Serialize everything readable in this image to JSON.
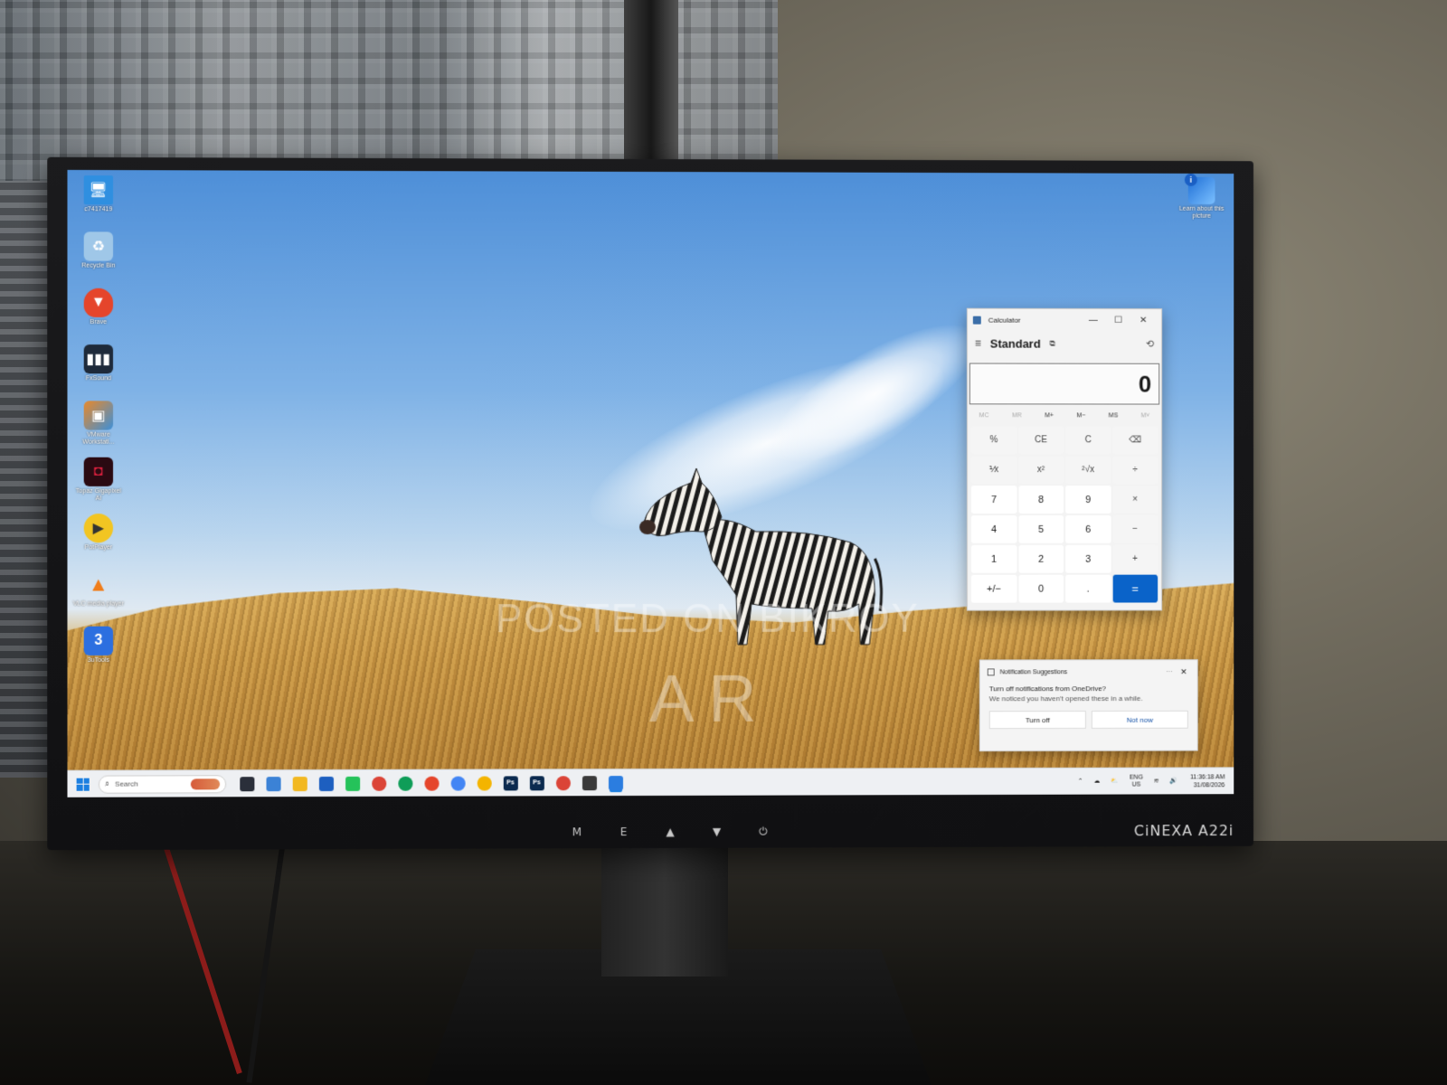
{
  "monitor": {
    "brand": "CiNEXA A22i",
    "buttons": [
      "M",
      "E",
      "▲",
      "▼",
      "⏻"
    ]
  },
  "wallpaper": {
    "watermark_line1": "POSTED ON BIKROY",
    "watermark_line2": "AR"
  },
  "desktop_icons": [
    {
      "label": "c7417419",
      "icon": "this-pc-icon",
      "color": "#2f8fe0"
    },
    {
      "label": "Recycle Bin",
      "icon": "recycle-bin-icon",
      "color": "#9fc7e8"
    },
    {
      "label": "Brave",
      "icon": "brave-icon",
      "color": "#e5452b"
    },
    {
      "label": "FxSound",
      "icon": "fxsound-icon",
      "color": "#1e2a3a"
    },
    {
      "label": "VMware Workstati...",
      "icon": "vmware-icon",
      "color": "#e9892a"
    },
    {
      "label": "Topaz Gigapixel AI",
      "icon": "topaz-icon",
      "color": "#b0102c"
    },
    {
      "label": "PotPlayer",
      "icon": "potplayer-icon",
      "color": "#f2c522"
    },
    {
      "label": "VLC media player",
      "icon": "vlc-icon",
      "color": "#f07d1a"
    },
    {
      "label": "3uTools",
      "icon": "3utools-icon",
      "color": "#2c6fe0"
    }
  ],
  "learn_picture": {
    "label": "Learn about this picture",
    "dot": "i"
  },
  "calculator": {
    "title": "Calculator",
    "mode": "Standard",
    "display": "0",
    "memory": [
      "MC",
      "MR",
      "M+",
      "M−",
      "MS",
      "M˅"
    ],
    "keys": [
      "%",
      "CE",
      "C",
      "⌫",
      "⅟x",
      "x²",
      "²√x",
      "÷",
      "7",
      "8",
      "9",
      "×",
      "4",
      "5",
      "6",
      "−",
      "1",
      "2",
      "3",
      "+",
      "+/−",
      "0",
      ".",
      "="
    ]
  },
  "notification": {
    "title": "Notification Suggestions",
    "more": "···",
    "heading": "Turn off notifications from OneDrive?",
    "body": "We noticed you haven't opened these in a while.",
    "btn_turn_off": "Turn off",
    "btn_not_now": "Not now"
  },
  "taskbar": {
    "search_placeholder": "Search",
    "apps": [
      {
        "name": "task-view",
        "color": "#2a2f3a",
        "text": ""
      },
      {
        "name": "widgets",
        "color": "#3b82d6",
        "text": ""
      },
      {
        "name": "file-explorer",
        "color": "#f2b821",
        "text": ""
      },
      {
        "name": "microsoft-store",
        "color": "#1d5fc0",
        "text": ""
      },
      {
        "name": "whatsapp",
        "color": "#25c25a",
        "text": ""
      },
      {
        "name": "chrome-1",
        "color": "#db4437",
        "text": ""
      },
      {
        "name": "chrome-2",
        "color": "#0f9d58",
        "text": ""
      },
      {
        "name": "brave",
        "color": "#e5452b",
        "text": ""
      },
      {
        "name": "chrome-3",
        "color": "#4285f4",
        "text": ""
      },
      {
        "name": "chrome-4",
        "color": "#f4b400",
        "text": ""
      },
      {
        "name": "photoshop-1",
        "color": "#0b2a4f",
        "text": "Ps"
      },
      {
        "name": "photoshop-2",
        "color": "#0b2a4f",
        "text": "Ps"
      },
      {
        "name": "chrome-5",
        "color": "#db4437",
        "text": ""
      },
      {
        "name": "app-square",
        "color": "#3a3a3a",
        "text": ""
      },
      {
        "name": "calculator",
        "color": "#2b7de0",
        "text": ""
      }
    ],
    "lang_line1": "ENG",
    "lang_line2": "US",
    "time": "11:36:18 AM",
    "date": "31/08/2026"
  }
}
